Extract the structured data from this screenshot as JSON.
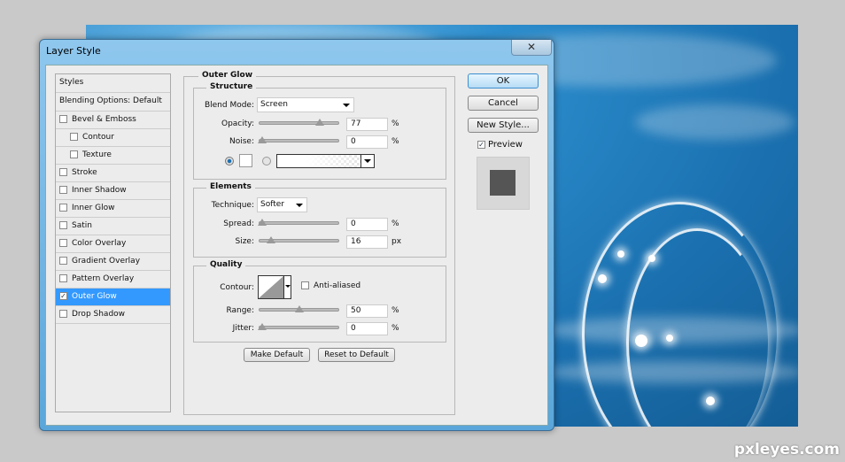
{
  "dialog": {
    "title": "Layer Style",
    "close": "✕"
  },
  "styles_panel": {
    "header": "Styles",
    "blending": "Blending Options: Default",
    "items": [
      {
        "label": "Bevel & Emboss",
        "checked": false,
        "indent": false
      },
      {
        "label": "Contour",
        "checked": false,
        "indent": true
      },
      {
        "label": "Texture",
        "checked": false,
        "indent": true
      },
      {
        "label": "Stroke",
        "checked": false,
        "indent": false
      },
      {
        "label": "Inner Shadow",
        "checked": false,
        "indent": false
      },
      {
        "label": "Inner Glow",
        "checked": false,
        "indent": false
      },
      {
        "label": "Satin",
        "checked": false,
        "indent": false
      },
      {
        "label": "Color Overlay",
        "checked": false,
        "indent": false
      },
      {
        "label": "Gradient Overlay",
        "checked": false,
        "indent": false
      },
      {
        "label": "Pattern Overlay",
        "checked": false,
        "indent": false
      },
      {
        "label": "Outer Glow",
        "checked": true,
        "indent": false,
        "selected": true
      },
      {
        "label": "Drop Shadow",
        "checked": false,
        "indent": false
      }
    ]
  },
  "outer_glow": {
    "title": "Outer Glow",
    "structure": {
      "title": "Structure",
      "blend_mode_label": "Blend Mode:",
      "blend_mode": "Screen",
      "opacity_label": "Opacity:",
      "opacity": "77",
      "opacity_unit": "%",
      "noise_label": "Noise:",
      "noise": "0",
      "noise_unit": "%",
      "glow_color": "#ffffff",
      "color_mode": "solid"
    },
    "elements": {
      "title": "Elements",
      "technique_label": "Technique:",
      "technique": "Softer",
      "spread_label": "Spread:",
      "spread": "0",
      "spread_unit": "%",
      "size_label": "Size:",
      "size": "16",
      "size_unit": "px",
      "size_max": 250
    },
    "quality": {
      "title": "Quality",
      "contour_label": "Contour:",
      "anti_aliased_label": "Anti-aliased",
      "anti_aliased": false,
      "range_label": "Range:",
      "range": "50",
      "range_unit": "%",
      "jitter_label": "Jitter:",
      "jitter": "0",
      "jitter_unit": "%"
    },
    "make_default": "Make Default",
    "reset_default": "Reset to Default"
  },
  "actions": {
    "ok": "OK",
    "cancel": "Cancel",
    "new_style": "New Style...",
    "preview_label": "Preview",
    "preview": true
  },
  "watermark": "pxleyes.com"
}
